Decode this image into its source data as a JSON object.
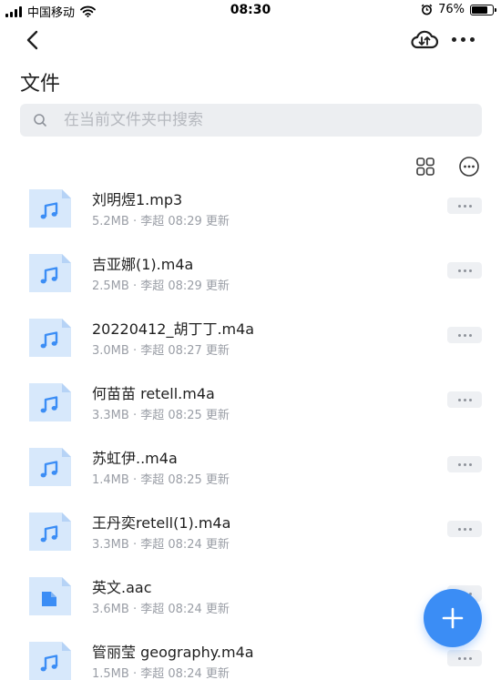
{
  "status_bar": {
    "carrier": "中国移动",
    "time": "08:30",
    "battery_text": "76%",
    "battery_level": 0.76
  },
  "nav": {
    "back_icon": "chevron-left-icon",
    "cloud_icon": "cloud-sync-icon",
    "more_icon": "more-horizontal-icon"
  },
  "page": {
    "title": "文件"
  },
  "search": {
    "placeholder": "在当前文件夹中搜索",
    "value": ""
  },
  "toolbar": {
    "grid_icon": "grid-view-icon",
    "options_icon": "more-circle-icon"
  },
  "files": [
    {
      "name": "刘明煜1.mp3",
      "meta": "5.2MB · 李超 08:29 更新",
      "type": "audio"
    },
    {
      "name": "吉亚娜(1).m4a",
      "meta": "2.5MB · 李超 08:29 更新",
      "type": "audio"
    },
    {
      "name": "20220412_胡丁丁.m4a",
      "meta": "3.0MB · 李超 08:27 更新",
      "type": "audio"
    },
    {
      "name": "何苗苗 retell.m4a",
      "meta": "3.3MB · 李超 08:25 更新",
      "type": "audio"
    },
    {
      "name": "苏虹伊..m4a",
      "meta": "1.4MB · 李超 08:25 更新",
      "type": "audio"
    },
    {
      "name": "王丹奕retell(1).m4a",
      "meta": "3.3MB · 李超 08:24 更新",
      "type": "audio"
    },
    {
      "name": "英文.aac",
      "meta": "3.6MB · 李超 08:24 更新",
      "type": "generic"
    },
    {
      "name": "管丽莹 geography.m4a",
      "meta": "1.5MB · 李超 08:24 更新",
      "type": "audio"
    }
  ],
  "fab": {
    "icon": "plus-icon",
    "color": "#3b8df5"
  },
  "colors": {
    "file_icon_bg": "#d7e8fb",
    "file_icon_fold": "#b6d3f6",
    "file_icon_glyph": "#3b8df5",
    "meta_text": "#9a9ea6"
  }
}
